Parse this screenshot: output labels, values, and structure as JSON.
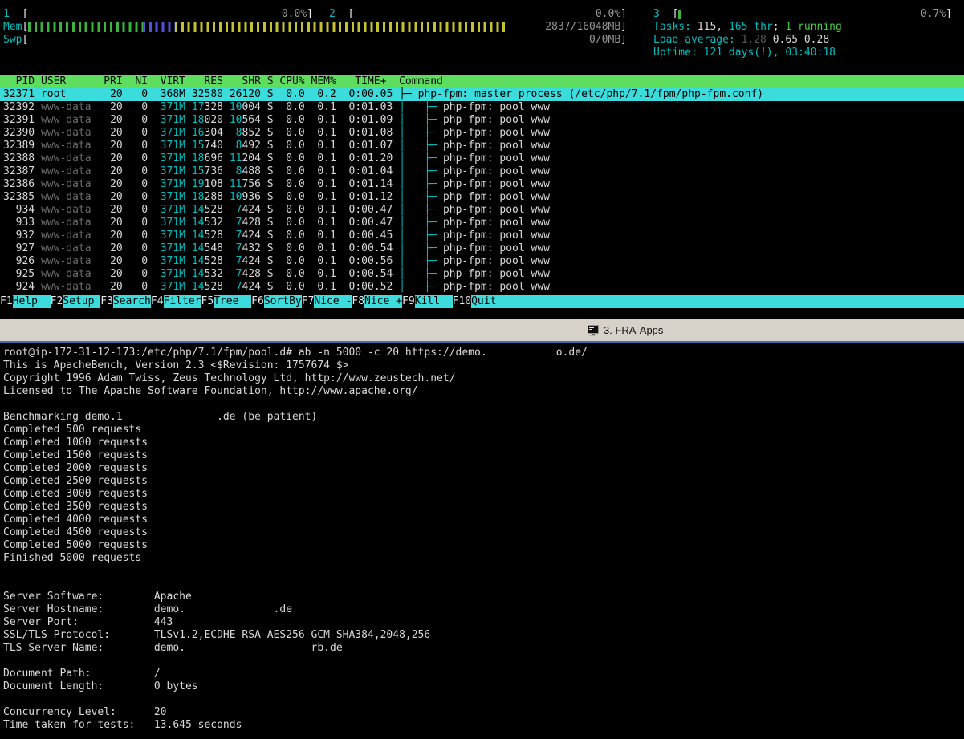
{
  "htop": {
    "cpus": [
      {
        "label": "1  ",
        "value": "0.0%",
        "segments": []
      },
      {
        "label": "2  ",
        "value": "0.0%",
        "segments": []
      },
      {
        "label": "3  ",
        "value": "0.7%",
        "segments": [
          {
            "color": "green",
            "pct": 1.0
          }
        ]
      }
    ],
    "mem": {
      "label": "Mem",
      "value": "2837/16048MB",
      "segments": [
        {
          "color": "green",
          "pct": 19.3
        },
        {
          "color": "blue",
          "pct": 5.4
        },
        {
          "color": "yellow",
          "pct": 56.1
        }
      ]
    },
    "swp": {
      "label": "Swp",
      "value": "0/0MB",
      "segments": []
    },
    "tasks": {
      "label": "Tasks: ",
      "parts": [
        {
          "t": "115, ",
          "c": "w"
        },
        {
          "t": "165 thr",
          "c": "cy"
        },
        {
          "t": "; ",
          "c": "w"
        },
        {
          "t": "1 running",
          "c": "gr"
        }
      ]
    },
    "load": {
      "label": "Load average: ",
      "parts": [
        {
          "t": "1.28 ",
          "c": "dim"
        },
        {
          "t": "0.65 ",
          "c": "w"
        },
        {
          "t": "0.28",
          "c": "w"
        }
      ]
    },
    "uptime": {
      "label": "Uptime: ",
      "parts": [
        {
          "t": "121 days(!), 03:40:18",
          "c": "cy"
        }
      ]
    },
    "table_header": "  PID USER      PRI  NI  VIRT   RES   SHR S CPU% MEM%   TIME+  Command",
    "processes": [
      {
        "pid": "32371",
        "user": "root",
        "pri": "20",
        "ni": "0",
        "virt": "368M",
        "res": "32580",
        "shr": "26120",
        "s": "S",
        "cpu": "0.0",
        "mem": "0.2",
        "time": "0:00.05",
        "tree": "├─ ",
        "cmd": "php-fpm: master process (/etc/php/7.1/fpm/php-fpm.conf)",
        "selected": true
      },
      {
        "pid": "32392",
        "user": "www-data",
        "pri": "20",
        "ni": "0",
        "virt": "371M",
        "res": "17328",
        "shr": "10004",
        "s": "S",
        "cpu": "0.0",
        "mem": "0.1",
        "time": "0:01.03",
        "tree": "│   ├─ ",
        "cmd": "php-fpm: pool www",
        "selected": false
      },
      {
        "pid": "32391",
        "user": "www-data",
        "pri": "20",
        "ni": "0",
        "virt": "371M",
        "res": "18020",
        "shr": "10564",
        "s": "S",
        "cpu": "0.0",
        "mem": "0.1",
        "time": "0:01.09",
        "tree": "│   ├─ ",
        "cmd": "php-fpm: pool www",
        "selected": false
      },
      {
        "pid": "32390",
        "user": "www-data",
        "pri": "20",
        "ni": "0",
        "virt": "371M",
        "res": "16304",
        "shr": "8852",
        "s": "S",
        "cpu": "0.0",
        "mem": "0.1",
        "time": "0:01.08",
        "tree": "│   ├─ ",
        "cmd": "php-fpm: pool www",
        "selected": false
      },
      {
        "pid": "32389",
        "user": "www-data",
        "pri": "20",
        "ni": "0",
        "virt": "371M",
        "res": "15740",
        "shr": "8492",
        "s": "S",
        "cpu": "0.0",
        "mem": "0.1",
        "time": "0:01.07",
        "tree": "│   ├─ ",
        "cmd": "php-fpm: pool www",
        "selected": false
      },
      {
        "pid": "32388",
        "user": "www-data",
        "pri": "20",
        "ni": "0",
        "virt": "371M",
        "res": "18696",
        "shr": "11204",
        "s": "S",
        "cpu": "0.0",
        "mem": "0.1",
        "time": "0:01.20",
        "tree": "│   ├─ ",
        "cmd": "php-fpm: pool www",
        "selected": false
      },
      {
        "pid": "32387",
        "user": "www-data",
        "pri": "20",
        "ni": "0",
        "virt": "371M",
        "res": "15736",
        "shr": "8488",
        "s": "S",
        "cpu": "0.0",
        "mem": "0.1",
        "time": "0:01.04",
        "tree": "│   ├─ ",
        "cmd": "php-fpm: pool www",
        "selected": false
      },
      {
        "pid": "32386",
        "user": "www-data",
        "pri": "20",
        "ni": "0",
        "virt": "371M",
        "res": "19108",
        "shr": "11756",
        "s": "S",
        "cpu": "0.0",
        "mem": "0.1",
        "time": "0:01.14",
        "tree": "│   ├─ ",
        "cmd": "php-fpm: pool www",
        "selected": false
      },
      {
        "pid": "32385",
        "user": "www-data",
        "pri": "20",
        "ni": "0",
        "virt": "371M",
        "res": "18288",
        "shr": "10936",
        "s": "S",
        "cpu": "0.0",
        "mem": "0.1",
        "time": "0:01.12",
        "tree": "│   ├─ ",
        "cmd": "php-fpm: pool www",
        "selected": false
      },
      {
        "pid": "934",
        "user": "www-data",
        "pri": "20",
        "ni": "0",
        "virt": "371M",
        "res": "14528",
        "shr": "7424",
        "s": "S",
        "cpu": "0.0",
        "mem": "0.1",
        "time": "0:00.47",
        "tree": "│   ├─ ",
        "cmd": "php-fpm: pool www",
        "selected": false
      },
      {
        "pid": "933",
        "user": "www-data",
        "pri": "20",
        "ni": "0",
        "virt": "371M",
        "res": "14532",
        "shr": "7428",
        "s": "S",
        "cpu": "0.0",
        "mem": "0.1",
        "time": "0:00.47",
        "tree": "│   ├─ ",
        "cmd": "php-fpm: pool www",
        "selected": false
      },
      {
        "pid": "932",
        "user": "www-data",
        "pri": "20",
        "ni": "0",
        "virt": "371M",
        "res": "14528",
        "shr": "7424",
        "s": "S",
        "cpu": "0.0",
        "mem": "0.1",
        "time": "0:00.45",
        "tree": "│   ├─ ",
        "cmd": "php-fpm: pool www",
        "selected": false
      },
      {
        "pid": "927",
        "user": "www-data",
        "pri": "20",
        "ni": "0",
        "virt": "371M",
        "res": "14548",
        "shr": "7432",
        "s": "S",
        "cpu": "0.0",
        "mem": "0.1",
        "time": "0:00.54",
        "tree": "│   ├─ ",
        "cmd": "php-fpm: pool www",
        "selected": false
      },
      {
        "pid": "926",
        "user": "www-data",
        "pri": "20",
        "ni": "0",
        "virt": "371M",
        "res": "14528",
        "shr": "7424",
        "s": "S",
        "cpu": "0.0",
        "mem": "0.1",
        "time": "0:00.56",
        "tree": "│   ├─ ",
        "cmd": "php-fpm: pool www",
        "selected": false
      },
      {
        "pid": "925",
        "user": "www-data",
        "pri": "20",
        "ni": "0",
        "virt": "371M",
        "res": "14532",
        "shr": "7428",
        "s": "S",
        "cpu": "0.0",
        "mem": "0.1",
        "time": "0:00.54",
        "tree": "│   ├─ ",
        "cmd": "php-fpm: pool www",
        "selected": false
      },
      {
        "pid": "924",
        "user": "www-data",
        "pri": "20",
        "ni": "0",
        "virt": "371M",
        "res": "14528",
        "shr": "7424",
        "s": "S",
        "cpu": "0.0",
        "mem": "0.1",
        "time": "0:00.52",
        "tree": "│   ├─ ",
        "cmd": "php-fpm: pool www",
        "selected": false
      }
    ],
    "fkeys": [
      {
        "key": "F1",
        "label": "Help  "
      },
      {
        "key": "F2",
        "label": "Setup "
      },
      {
        "key": "F3",
        "label": "Search"
      },
      {
        "key": "F4",
        "label": "Filter"
      },
      {
        "key": "F5",
        "label": "Tree  "
      },
      {
        "key": "F6",
        "label": "SortBy"
      },
      {
        "key": "F7",
        "label": "Nice -"
      },
      {
        "key": "F8",
        "label": "Nice +"
      },
      {
        "key": "F9",
        "label": "Kill  "
      },
      {
        "key": "F10",
        "label": "Quit"
      }
    ]
  },
  "tab": {
    "title": "3. FRA-Apps",
    "icon": "terminal-window-icon"
  },
  "terminal": {
    "lines": [
      "root@ip-172-31-12-173:/etc/php/7.1/fpm/pool.d# ab -n 5000 -c 20 https://demo.           o.de/",
      "This is ApacheBench, Version 2.3 <$Revision: 1757674 $>",
      "Copyright 1996 Adam Twiss, Zeus Technology Ltd, http://www.zeustech.net/",
      "Licensed to The Apache Software Foundation, http://www.apache.org/",
      "",
      "Benchmarking demo.1               .de (be patient)",
      "Completed 500 requests",
      "Completed 1000 requests",
      "Completed 1500 requests",
      "Completed 2000 requests",
      "Completed 2500 requests",
      "Completed 3000 requests",
      "Completed 3500 requests",
      "Completed 4000 requests",
      "Completed 4500 requests",
      "Completed 5000 requests",
      "Finished 5000 requests",
      "",
      "",
      "Server Software:        Apache",
      "Server Hostname:        demo.              .de",
      "Server Port:            443",
      "SSL/TLS Protocol:       TLSv1.2,ECDHE-RSA-AES256-GCM-SHA384,2048,256",
      "TLS Server Name:        demo.                    rb.de",
      "",
      "Document Path:          /",
      "Document Length:        0 bytes",
      "",
      "Concurrency Level:      20",
      "Time taken for tests:   13.645 seconds"
    ]
  }
}
